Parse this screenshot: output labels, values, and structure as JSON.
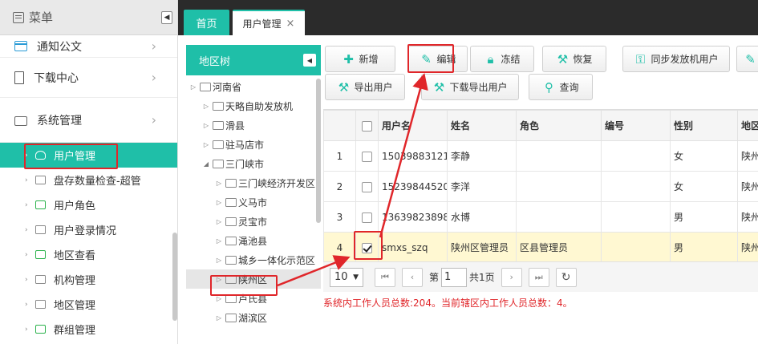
{
  "sidebar": {
    "title": "菜单",
    "collapse_glyph": "◀",
    "items": [
      {
        "label": "通知公文",
        "icon": "notice-icon"
      },
      {
        "label": "下载中心",
        "icon": "download-icon"
      },
      {
        "label": "系统管理",
        "icon": "folder-icon"
      }
    ],
    "sub_items": [
      {
        "label": "用户管理",
        "icon": "user-icon",
        "active": true
      },
      {
        "label": "盘存数量检查-超管",
        "icon": "folder-icon"
      },
      {
        "label": "用户角色",
        "icon": "role-icon"
      },
      {
        "label": "用户登录情况",
        "icon": "folder-icon"
      },
      {
        "label": "地区查看",
        "icon": "org-icon"
      },
      {
        "label": "机构管理",
        "icon": "folder-icon"
      },
      {
        "label": "地区管理",
        "icon": "folder-icon"
      },
      {
        "label": "群组管理",
        "icon": "group-icon"
      }
    ]
  },
  "tabs": {
    "home": "首页",
    "user_mgmt": "用户管理",
    "close": "×"
  },
  "tree": {
    "title": "地区树",
    "collapse_glyph": "◀",
    "nodes": [
      {
        "label": "河南省",
        "arrow": "▷"
      },
      {
        "label": "天略自助发放机",
        "arrow": "▷"
      },
      {
        "label": "滑县",
        "arrow": "▷"
      },
      {
        "label": "驻马店市",
        "arrow": "▷"
      },
      {
        "label": "三门峡市",
        "arrow": "◢"
      },
      {
        "label": "三门峡经济开发区",
        "arrow": "▷"
      },
      {
        "label": "义马市",
        "arrow": "▷"
      },
      {
        "label": "灵宝市",
        "arrow": "▷"
      },
      {
        "label": "渑池县",
        "arrow": "▷"
      },
      {
        "label": "城乡一体化示范区",
        "arrow": "▷"
      },
      {
        "label": "陕州区",
        "arrow": "▷",
        "selected": true
      },
      {
        "label": "卢氏县",
        "arrow": "▷"
      },
      {
        "label": "湖滨区",
        "arrow": "▷"
      }
    ]
  },
  "toolbar": {
    "add": "新增",
    "edit": "编辑",
    "freeze": "冻结",
    "restore": "恢复",
    "sync": "同步发放机用户",
    "export_user": "导出用户",
    "download_export": "下载导出用户",
    "query": "查询"
  },
  "grid": {
    "columns": [
      "用户名",
      "姓名",
      "角色",
      "编号",
      "性别",
      "地区"
    ],
    "rows": [
      {
        "num": "1",
        "checked": false,
        "username": "15039883121",
        "name": "李静",
        "role": "",
        "code": "",
        "gender": "女",
        "region": "陕州"
      },
      {
        "num": "2",
        "checked": false,
        "username": "15239844520",
        "name": "李洋",
        "role": "",
        "code": "",
        "gender": "女",
        "region": "陕州"
      },
      {
        "num": "3",
        "checked": false,
        "username": "13639823898",
        "name": "水博",
        "role": "",
        "code": "",
        "gender": "男",
        "region": "陕州"
      },
      {
        "num": "4",
        "checked": true,
        "username": "smxs_szq",
        "name": "陕州区管理员",
        "role": "区县管理员",
        "code": "",
        "gender": "男",
        "region": "陕州"
      }
    ]
  },
  "pager": {
    "page_size": "10",
    "page_prefix": "第",
    "page_value": "1",
    "page_total": "共1页"
  },
  "status": "系统内工作人员总数:204。当前辖区内工作人员总数：4。",
  "colors": {
    "accent": "#1fbfa8",
    "highlight_row": "#fff8d2",
    "annotation": "#e0262a"
  }
}
